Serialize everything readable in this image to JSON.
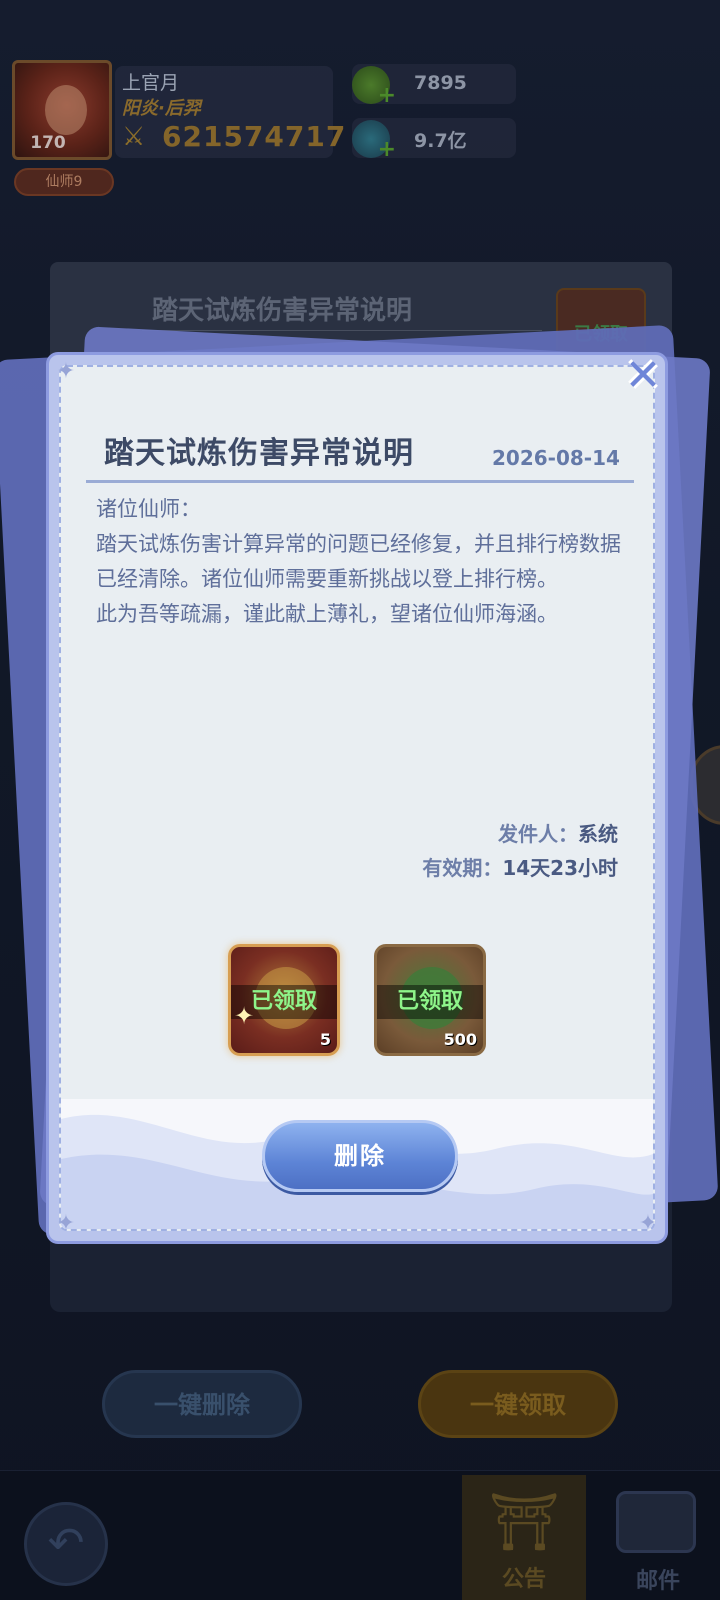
{
  "player": {
    "name": "上官月",
    "title": "阳炎·后羿",
    "level": "170",
    "rank_badge": "仙师9",
    "power": "621574717"
  },
  "resources": [
    {
      "icon": "green-gem-icon",
      "value": "7895"
    },
    {
      "icon": "blue-crystal-icon",
      "value": "9.7亿"
    }
  ],
  "background_mail": {
    "title": "踏天试炼伤害异常说明",
    "reward_status": "已领取"
  },
  "modal": {
    "title": "踏天试炼伤害异常说明",
    "date": "2026-08-14",
    "body": [
      "诸位仙师：",
      "踏天试炼伤害计算异常的问题已经修复，并且排行榜数据已经清除。诸位仙师需要重新挑战以登上排行榜。",
      "此为吾等疏漏，谨此献上薄礼，望诸位仙师海涵。"
    ],
    "sender_label": "发件人：",
    "sender_value": "系统",
    "expiry_label": "有效期：",
    "expiry_value": "14天23小时",
    "rewards": [
      {
        "icon": "golden-helmet-icon",
        "status": "已领取",
        "quantity": "5"
      },
      {
        "icon": "jade-disc-icon",
        "status": "已领取",
        "quantity": "500"
      }
    ],
    "delete_label": "删除"
  },
  "bottom_buttons": {
    "delete_all": "一键删除",
    "claim_all": "一键领取"
  },
  "tabs": {
    "notice": "公告",
    "mail": "邮件"
  },
  "colors": {
    "modal_frame": "#b9c4ec",
    "modal_paper": "#e9eef2",
    "title_text": "#3d4a66",
    "body_text": "#5f6f9a",
    "delete_button": "#5d84d6",
    "claimed_text": "#8ef58a"
  }
}
